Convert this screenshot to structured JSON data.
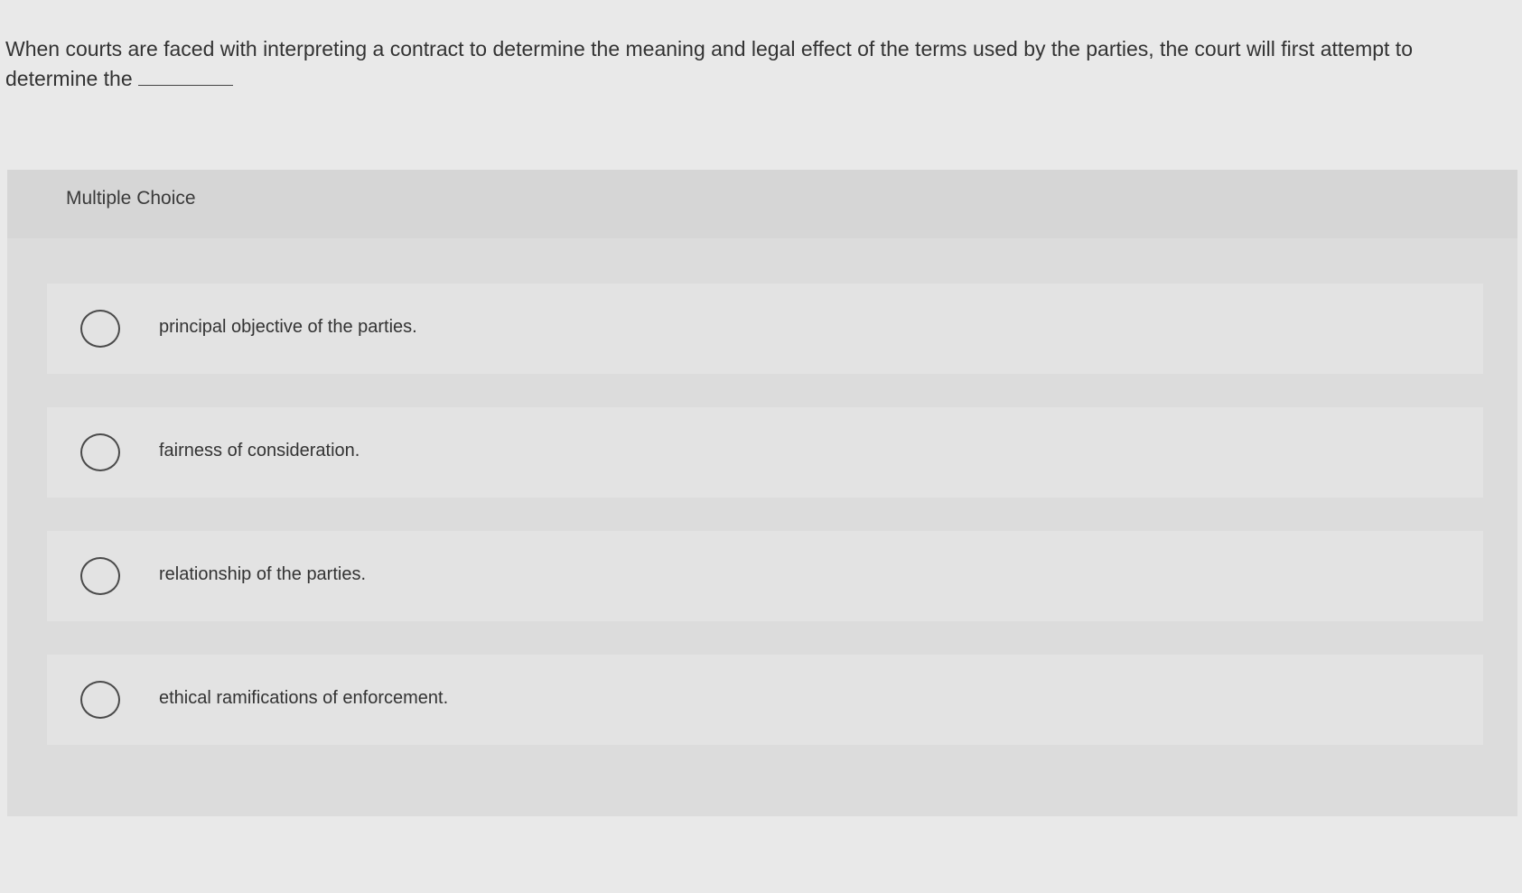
{
  "question": {
    "text": "When courts are faced with interpreting a contract to determine the meaning and legal effect of the terms used by the parties, the court will first attempt to determine the"
  },
  "panel": {
    "header_label": "Multiple Choice"
  },
  "choices": [
    {
      "label": "principal objective of the parties."
    },
    {
      "label": "fairness of consideration."
    },
    {
      "label": "relationship of the parties."
    },
    {
      "label": "ethical ramifications of enforcement."
    }
  ]
}
